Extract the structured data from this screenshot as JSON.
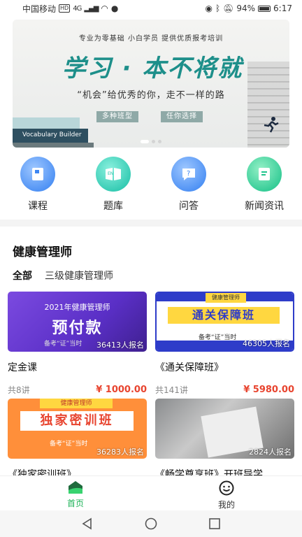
{
  "status_bar": {
    "carrier": "中国移动",
    "hd": "HD",
    "network": "4G",
    "battery": "94%",
    "time": "6:17"
  },
  "banner": {
    "top_text": "专业为零基础  小白学员  提供优质报考培训",
    "slogan": "学习 · 本不将就",
    "subtitle": "“机会”给优秀的你，走不一样的路",
    "tags": [
      "多种班型",
      "任你选择"
    ],
    "book_title": "Vocabulary Builder",
    "active_slide": 1,
    "slide_count": 3
  },
  "nav": [
    {
      "label": "课程",
      "icon": "course-book-icon",
      "color": "blue"
    },
    {
      "label": "题库",
      "icon": "question-bank-icon",
      "color": "teal"
    },
    {
      "label": "问答",
      "icon": "qa-chat-icon",
      "color": "blue"
    },
    {
      "label": "新闻资讯",
      "icon": "news-icon",
      "color": "green"
    }
  ],
  "section": {
    "title": "健康管理师",
    "filters": [
      "全部",
      "三级健康管理师"
    ],
    "active_filter": "全部"
  },
  "courses": [
    {
      "title": "定金课",
      "lessons": "共8讲",
      "price": "¥ 1000.00",
      "enrolled": "36413人报名",
      "image": {
        "year": "2021年健康管理师",
        "headline": "预付款",
        "sub": "备考“证”当时"
      }
    },
    {
      "title": "《通关保障班》",
      "lessons": "共141讲",
      "price": "¥ 5980.00",
      "enrolled": "46305人报名",
      "image": {
        "tag": "健康管理师",
        "headline": "通关保障班",
        "sub": "备考“证”当时"
      }
    },
    {
      "title": "《独家密训班》",
      "lessons": "",
      "price": "",
      "enrolled": "36283人报名",
      "image": {
        "tag": "健康管理师",
        "headline": "独家密训班",
        "sub": "备考“证”当时"
      }
    },
    {
      "title": "《畅学尊享班》开班导学",
      "lessons": "",
      "price": "",
      "enrolled": "2824人报名",
      "image": {}
    }
  ],
  "tab_bar": [
    {
      "label": "首页",
      "icon": "home-icon",
      "active": true
    },
    {
      "label": "我的",
      "icon": "smiley-profile-icon",
      "active": false
    }
  ],
  "colors": {
    "accent_green": "#20b35a",
    "price_red": "#e8442f",
    "banner_teal": "#1d8f8a"
  }
}
